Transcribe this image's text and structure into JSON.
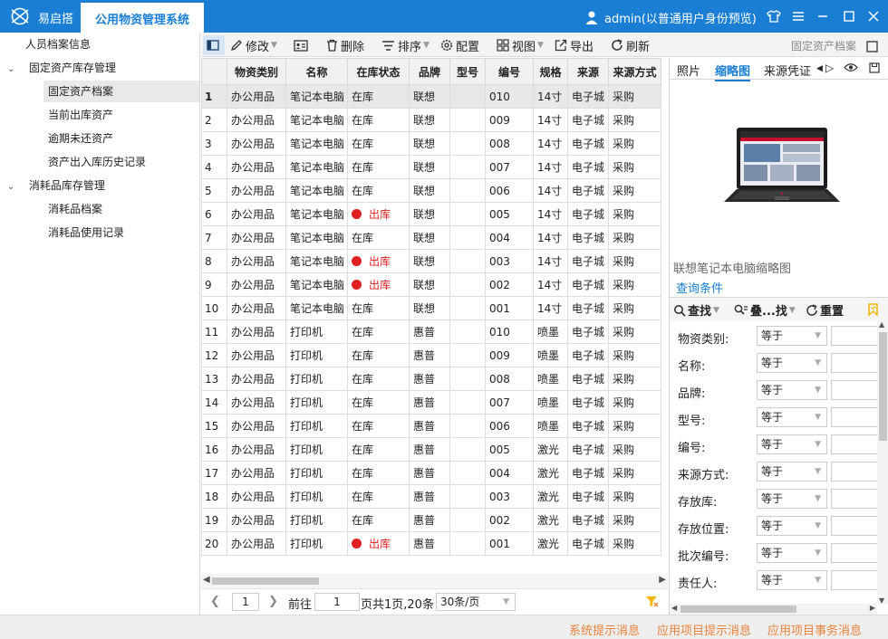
{
  "titlebar": {
    "app_name": "易启搭",
    "active_tab": "公用物资管理系统",
    "user": "admin(以普通用户身份预览)"
  },
  "leftnav": {
    "items": [
      {
        "label": "人员档案信息",
        "level": 0,
        "expandable": false
      },
      {
        "label": "固定资产库存管理",
        "level": 0,
        "expandable": true
      },
      {
        "label": "固定资产档案",
        "level": 1,
        "selected": true
      },
      {
        "label": "当前出库资产",
        "level": 1
      },
      {
        "label": "逾期未还资产",
        "level": 1
      },
      {
        "label": "资产出入库历史记录",
        "level": 1
      },
      {
        "label": "消耗品库存管理",
        "level": 0,
        "expandable": true
      },
      {
        "label": "消耗品档案",
        "level": 1
      },
      {
        "label": "消耗品使用记录",
        "level": 1
      }
    ]
  },
  "toolbar": {
    "edit": "修改",
    "delete": "删除",
    "sort": "排序",
    "config": "配置",
    "view": "视图",
    "export": "导出",
    "refresh": "刷新",
    "breadcrumb": "固定资产档案"
  },
  "grid": {
    "columns": [
      "物资类别",
      "名称",
      "在库状态",
      "品牌",
      "型号",
      "编号",
      "规格",
      "来源",
      "来源方式"
    ],
    "rows": [
      [
        "1",
        "办公用品",
        "笔记本电脑",
        "在库",
        "联想",
        "",
        "010",
        "14寸",
        "电子城",
        "采购"
      ],
      [
        "2",
        "办公用品",
        "笔记本电脑",
        "在库",
        "联想",
        "",
        "009",
        "14寸",
        "电子城",
        "采购"
      ],
      [
        "3",
        "办公用品",
        "笔记本电脑",
        "在库",
        "联想",
        "",
        "008",
        "14寸",
        "电子城",
        "采购"
      ],
      [
        "4",
        "办公用品",
        "笔记本电脑",
        "在库",
        "联想",
        "",
        "007",
        "14寸",
        "电子城",
        "采购"
      ],
      [
        "5",
        "办公用品",
        "笔记本电脑",
        "在库",
        "联想",
        "",
        "006",
        "14寸",
        "电子城",
        "采购"
      ],
      [
        "6",
        "办公用品",
        "笔记本电脑",
        "出库",
        "联想",
        "",
        "005",
        "14寸",
        "电子城",
        "采购"
      ],
      [
        "7",
        "办公用品",
        "笔记本电脑",
        "在库",
        "联想",
        "",
        "004",
        "14寸",
        "电子城",
        "采购"
      ],
      [
        "8",
        "办公用品",
        "笔记本电脑",
        "出库",
        "联想",
        "",
        "003",
        "14寸",
        "电子城",
        "采购"
      ],
      [
        "9",
        "办公用品",
        "笔记本电脑",
        "出库",
        "联想",
        "",
        "002",
        "14寸",
        "电子城",
        "采购"
      ],
      [
        "10",
        "办公用品",
        "笔记本电脑",
        "在库",
        "联想",
        "",
        "001",
        "14寸",
        "电子城",
        "采购"
      ],
      [
        "11",
        "办公用品",
        "打印机",
        "在库",
        "惠普",
        "",
        "010",
        "喷墨",
        "电子城",
        "采购"
      ],
      [
        "12",
        "办公用品",
        "打印机",
        "在库",
        "惠普",
        "",
        "009",
        "喷墨",
        "电子城",
        "采购"
      ],
      [
        "13",
        "办公用品",
        "打印机",
        "在库",
        "惠普",
        "",
        "008",
        "喷墨",
        "电子城",
        "采购"
      ],
      [
        "14",
        "办公用品",
        "打印机",
        "在库",
        "惠普",
        "",
        "007",
        "喷墨",
        "电子城",
        "采购"
      ],
      [
        "15",
        "办公用品",
        "打印机",
        "在库",
        "惠普",
        "",
        "006",
        "喷墨",
        "电子城",
        "采购"
      ],
      [
        "16",
        "办公用品",
        "打印机",
        "在库",
        "惠普",
        "",
        "005",
        "激光",
        "电子城",
        "采购"
      ],
      [
        "17",
        "办公用品",
        "打印机",
        "在库",
        "惠普",
        "",
        "004",
        "激光",
        "电子城",
        "采购"
      ],
      [
        "18",
        "办公用品",
        "打印机",
        "在库",
        "惠普",
        "",
        "003",
        "激光",
        "电子城",
        "采购"
      ],
      [
        "19",
        "办公用品",
        "打印机",
        "在库",
        "惠普",
        "",
        "002",
        "激光",
        "电子城",
        "采购"
      ],
      [
        "20",
        "办公用品",
        "打印机",
        "出库",
        "惠普",
        "",
        "001",
        "激光",
        "电子城",
        "采购"
      ]
    ],
    "out_status": "出库"
  },
  "pager": {
    "current_page": "1",
    "goto_label": "前往",
    "goto_value": "1",
    "summary": "页共1页,20条",
    "page_size": "30条/页"
  },
  "rightpanel": {
    "tabs": [
      "照片",
      "缩略图",
      "来源凭证"
    ],
    "active_tab": "缩略图",
    "thumbnail_caption": "联想笔记本电脑缩略图",
    "query_title": "查询条件",
    "search_btn": "查找",
    "advanced_btn": "叠...找",
    "reset_btn": "重置",
    "operator": "等于",
    "fields": [
      "物资类别:",
      "名称:",
      "品牌:",
      "型号:",
      "编号:",
      "来源方式:",
      "存放库:",
      "存放位置:",
      "批次编号:",
      "责任人:"
    ]
  },
  "statusbar": {
    "msg1": "系统提示消息",
    "msg2": "应用项目提示消息",
    "msg3": "应用项目事务消息"
  },
  "colors": {
    "accent": "#1a7fd4",
    "out_red": "#e02020",
    "status_orange": "#e8823c"
  }
}
